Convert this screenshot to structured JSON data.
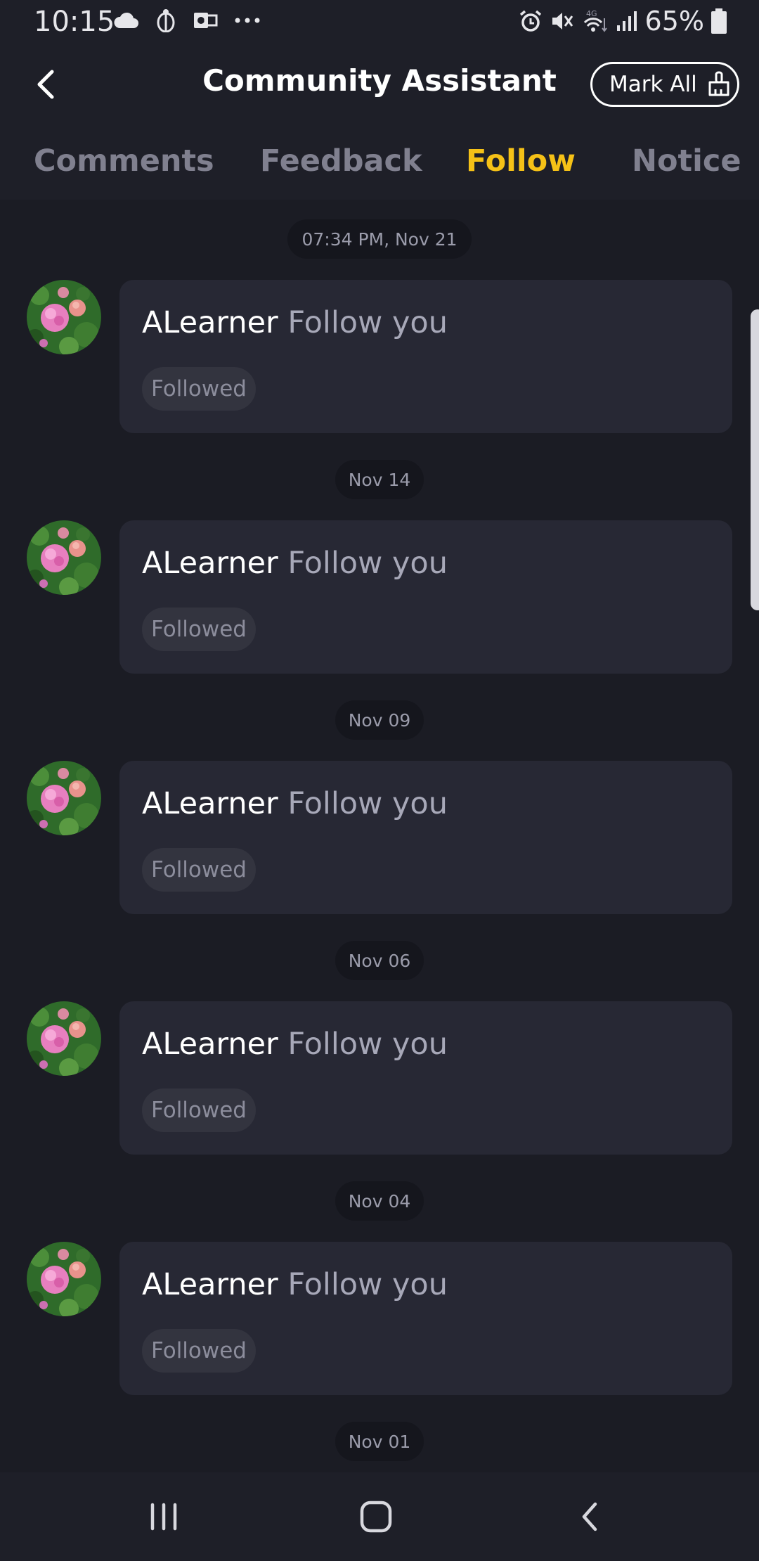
{
  "status_bar": {
    "time": "10:15",
    "left_icons": [
      "cloud-icon",
      "beetle-icon",
      "outlook-icon",
      "more-dots-icon"
    ],
    "right_icons": [
      "alarm-icon",
      "mute-icon",
      "4g-wifi-icon",
      "signal-icon"
    ],
    "battery_percent": "65%"
  },
  "header": {
    "title": "Community Assistant",
    "back_icon": "chevron-left-icon",
    "mark_all_label": "Mark All",
    "mark_all_icon": "broom-icon"
  },
  "tabs": [
    {
      "label": "Comments",
      "active": false
    },
    {
      "label": "Feedback",
      "active": false
    },
    {
      "label": "Follow",
      "active": true
    },
    {
      "label": "Notice",
      "active": false
    }
  ],
  "colors": {
    "accent": "#f5c117",
    "background": "#1b1c24",
    "card": "#272834"
  },
  "feed": [
    {
      "date": "07:34 PM, Nov 21",
      "username": "ALearner",
      "action": "Follow you",
      "status": "Followed"
    },
    {
      "date": "Nov 14",
      "username": "ALearner",
      "action": "Follow you",
      "status": "Followed"
    },
    {
      "date": "Nov 09",
      "username": "ALearner",
      "action": "Follow you",
      "status": "Followed"
    },
    {
      "date": "Nov 06",
      "username": "ALearner",
      "action": "Follow you",
      "status": "Followed"
    },
    {
      "date": "Nov 04",
      "username": "ALearner",
      "action": "Follow you",
      "status": "Followed"
    },
    {
      "date": "Nov 01"
    }
  ],
  "nav_bar": {
    "recents_icon": "recents-icon",
    "home_icon": "home-icon",
    "back_icon": "back-icon"
  }
}
